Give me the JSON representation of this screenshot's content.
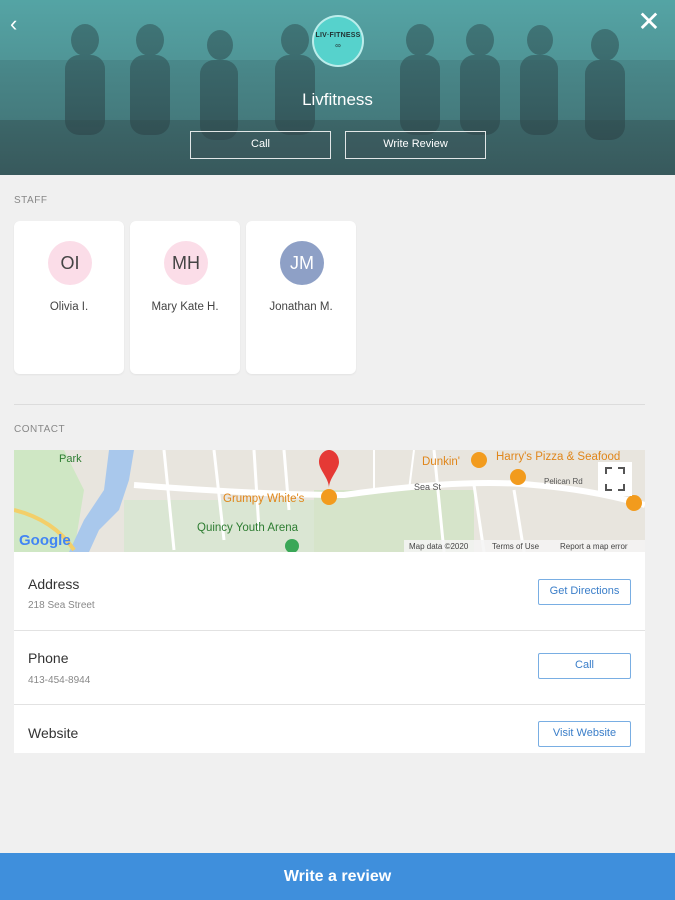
{
  "hero": {
    "back_icon": "‹",
    "close_icon": "✕",
    "logo_text": "LIV·FITNESS",
    "logo_sub": "∞",
    "title": "Livfitness",
    "call_label": "Call",
    "review_label": "Write Review"
  },
  "staff": {
    "section_label": "STAFF",
    "members": [
      {
        "initials": "OI",
        "name": "Olivia I.",
        "color": "#fbdde8"
      },
      {
        "initials": "MH",
        "name": "Mary Kate H.",
        "color": "#fbdde8"
      },
      {
        "initials": "JM",
        "name": "Jonathan M.",
        "color": "#8ea0c6"
      }
    ]
  },
  "contact": {
    "section_label": "CONTACT",
    "map": {
      "labels": {
        "park": "Park",
        "grumpy": "Grumpy White's",
        "quincy": "Quincy Youth Arena",
        "dunkin": "Dunkin'",
        "harrys": "Harry's Pizza & Seafood",
        "sea_st": "Sea St",
        "pelican": "Pelican Rd",
        "google": "Google",
        "map_data": "Map data ©2020",
        "terms": "Terms of Use",
        "report": "Report a map error"
      },
      "fullscreen_icon": "fullscreen-icon"
    },
    "rows": {
      "address": {
        "label": "Address",
        "value": "218 Sea Street",
        "button": "Get Directions"
      },
      "phone": {
        "label": "Phone",
        "value": "413-454-8944",
        "button": "Call"
      },
      "website": {
        "label": "Website",
        "button": "Visit Website"
      }
    }
  },
  "bottom_bar": {
    "label": "Write a review"
  },
  "colors": {
    "accent": "#3f8fdc",
    "button_border": "#79aee3"
  }
}
